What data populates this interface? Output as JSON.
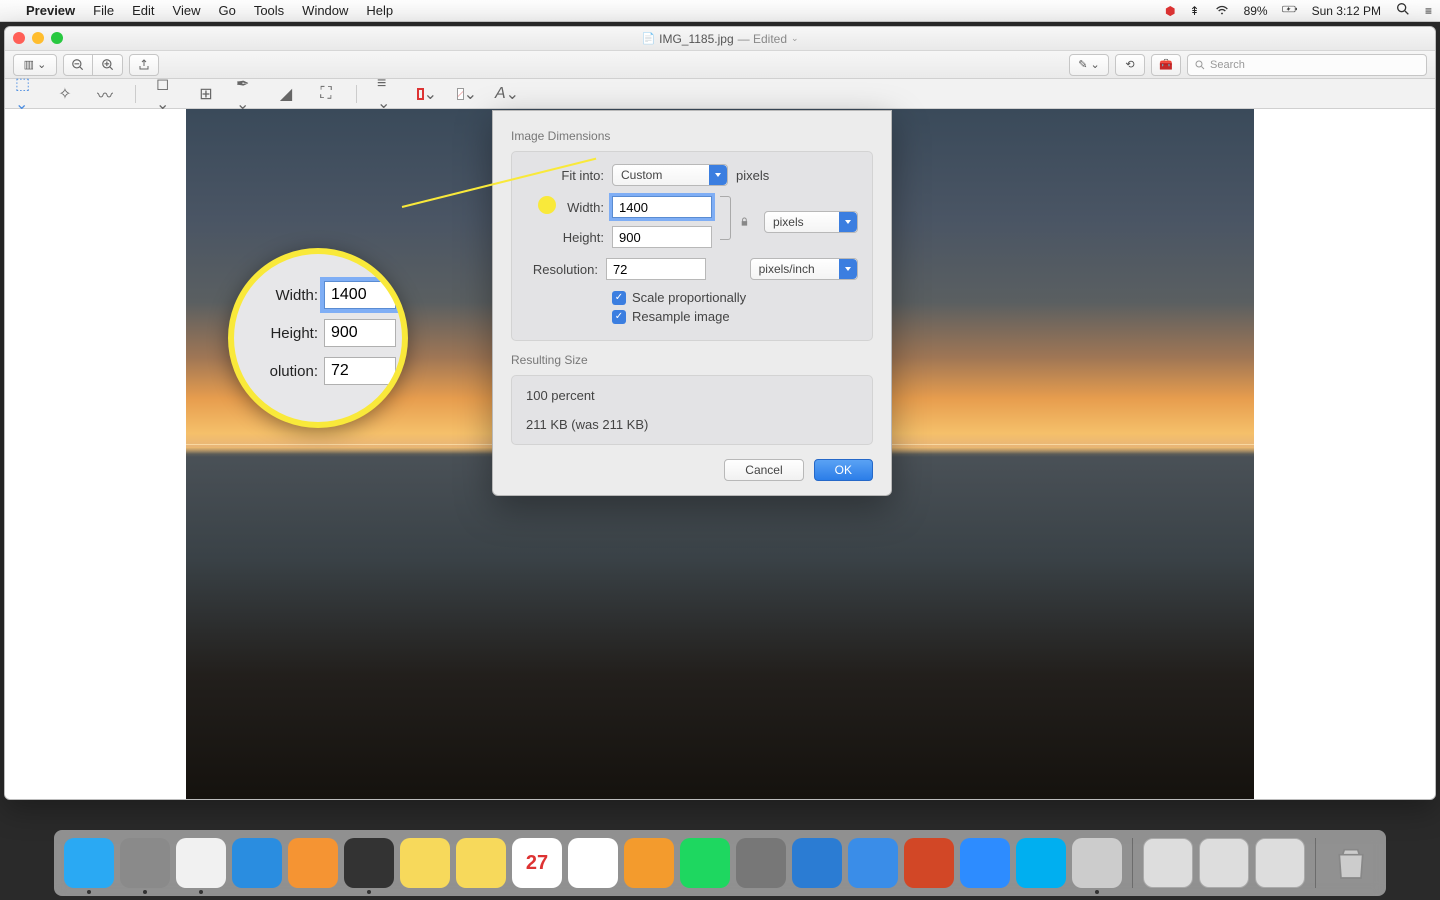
{
  "menubar": {
    "app": "Preview",
    "items": [
      "File",
      "Edit",
      "View",
      "Go",
      "Tools",
      "Window",
      "Help"
    ],
    "battery": "89%",
    "clock": "Sun 3:12 PM"
  },
  "window": {
    "filename": "IMG_1185.jpg",
    "status": "— Edited",
    "search_placeholder": "Search"
  },
  "dialog": {
    "title": "Image Dimensions",
    "fit_into_label": "Fit into:",
    "fit_into_value": "Custom",
    "fit_into_unit": "pixels",
    "width_label": "Width:",
    "width_value": "1400",
    "height_label": "Height:",
    "height_value": "900",
    "wh_unit": "pixels",
    "resolution_label": "Resolution:",
    "resolution_value": "72",
    "resolution_unit": "pixels/inch",
    "scale_label": "Scale proportionally",
    "resample_label": "Resample image",
    "result_title": "Resulting Size",
    "result_percent": "100 percent",
    "result_size": "211 KB (was 211 KB)",
    "cancel": "Cancel",
    "ok": "OK"
  },
  "lens": {
    "width_label": "Width:",
    "width_value": "1400",
    "height_label": "Height:",
    "height_value": "900",
    "resolution_label": "olution:",
    "resolution_value": "72"
  },
  "dock": {
    "items": [
      {
        "name": "finder",
        "bg": "#2aa9f3"
      },
      {
        "name": "launchpad",
        "bg": "#8a8a8a"
      },
      {
        "name": "chrome",
        "bg": "#f1f1f1"
      },
      {
        "name": "safari",
        "bg": "#2a8de0"
      },
      {
        "name": "firefox",
        "bg": "#f59433"
      },
      {
        "name": "mission-control",
        "bg": "#333"
      },
      {
        "name": "notes",
        "bg": "#f7d95b"
      },
      {
        "name": "stickies",
        "bg": "#f7d95b"
      },
      {
        "name": "calendar",
        "bg": "#fff",
        "text": "27"
      },
      {
        "name": "music",
        "bg": "#fff"
      },
      {
        "name": "books",
        "bg": "#f39b2d"
      },
      {
        "name": "spotify",
        "bg": "#1ed760"
      },
      {
        "name": "settings",
        "bg": "#777"
      },
      {
        "name": "word",
        "bg": "#2b7cd3"
      },
      {
        "name": "keynote",
        "bg": "#3a8de8"
      },
      {
        "name": "powerpoint",
        "bg": "#d24726"
      },
      {
        "name": "zoom",
        "bg": "#2d8cff"
      },
      {
        "name": "skype",
        "bg": "#00aff0"
      },
      {
        "name": "photos",
        "bg": "#ccc"
      }
    ]
  }
}
